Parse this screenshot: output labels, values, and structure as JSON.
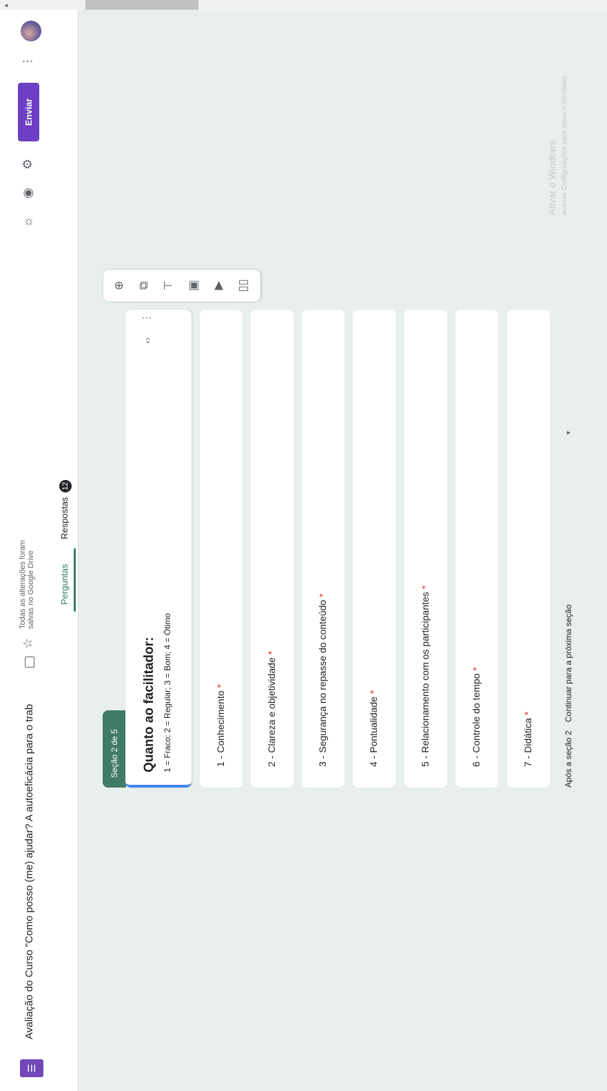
{
  "header": {
    "doc_title": "Avaliação do Curso \"Como posso (me) ajudar? A autoeficácia para o trab",
    "save_status": "Todas as alterações foram salvas no Google Drive",
    "tabs": [
      {
        "label": "Perguntas",
        "active": true
      },
      {
        "label": "Respostas",
        "badge": "12"
      }
    ],
    "send_label": "Enviar",
    "icons": [
      "forms-logo",
      "folder-icon",
      "star-icon",
      "palette-icon",
      "eye-icon",
      "gear-icon",
      "more-icon",
      "avatar"
    ]
  },
  "section": {
    "tab_label": "Seção 2 de 5",
    "title": "Quanto ao facilitador:",
    "description": "1 = Fraco;  2 = Regular;  3 = Bom;  4 = Ótimo"
  },
  "questions": [
    {
      "label": "1 - Conhecimento",
      "required": "*"
    },
    {
      "label": "2 - Clareza e objetividade",
      "required": "*"
    },
    {
      "label": "3 - Segurança no repasse do conteúdo",
      "required": "*"
    },
    {
      "label": "4 - Pontualidade",
      "required": "*"
    },
    {
      "label": "5 - Relacionamento com os participantes",
      "required": "*"
    },
    {
      "label": "6 - Controle do tempo",
      "required": "*"
    },
    {
      "label": "7 - Didática",
      "required": "*"
    }
  ],
  "after_section": {
    "label": "Após a seção 2",
    "value": "Continuar para a próxima seção"
  },
  "watermark": {
    "line1": "Ativar o Windows",
    "line2": "Acesse Configurações para ativar o Windows."
  },
  "colors": {
    "accent": "#6c3fc4",
    "section_tab": "#3f7b66",
    "background": "#e8efed",
    "required": "#d93025"
  }
}
